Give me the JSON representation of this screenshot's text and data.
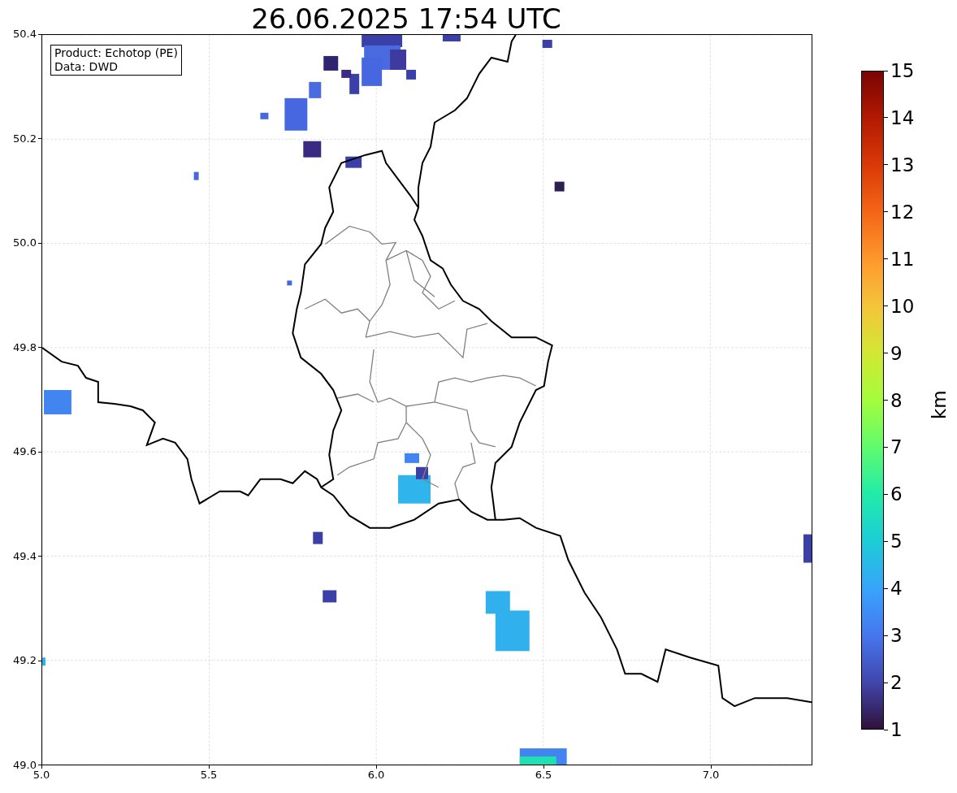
{
  "title": "26.06.2025 17:54 UTC",
  "legend": [
    "Product: Echotop (PE)",
    "Data: DWD"
  ],
  "x_ticks": [
    "5.0",
    "5.5",
    "6.0",
    "6.5",
    "7.0"
  ],
  "y_ticks": [
    "50.4",
    "50.2",
    "50.0",
    "49.8",
    "49.6",
    "49.4",
    "49.2",
    "49.0"
  ],
  "colorbar": {
    "label": "km",
    "ticks": [
      "15",
      "14",
      "13",
      "12",
      "11",
      "10",
      "9",
      "8",
      "7",
      "6",
      "5",
      "4",
      "3",
      "2",
      "1"
    ]
  }
}
